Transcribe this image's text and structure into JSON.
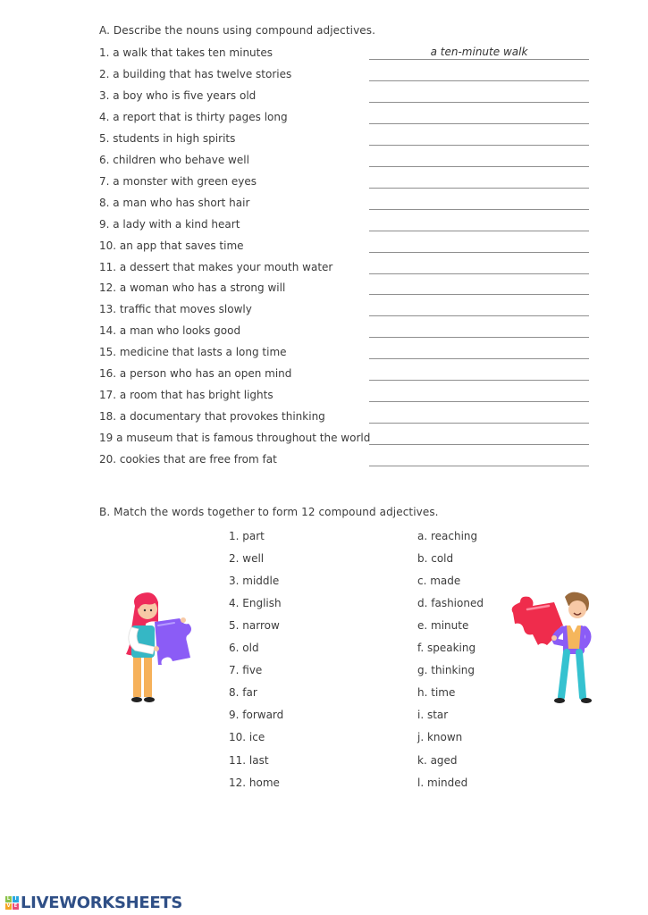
{
  "section_a": {
    "heading": "A. Describe the nouns using compound adjectives.",
    "items": [
      {
        "text": "1. a walk that takes ten minutes",
        "answer": "a ten-minute walk"
      },
      {
        "text": "2. a building that has twelve stories",
        "answer": ""
      },
      {
        "text": "3. a boy who is five years old",
        "answer": ""
      },
      {
        "text": "4. a report that is thirty pages long",
        "answer": ""
      },
      {
        "text": "5. students in high spirits",
        "answer": ""
      },
      {
        "text": "6. children who behave well",
        "answer": ""
      },
      {
        "text": "7. a monster with green eyes",
        "answer": ""
      },
      {
        "text": "8. a man who has short hair",
        "answer": ""
      },
      {
        "text": "9. a lady with a kind heart",
        "answer": ""
      },
      {
        "text": "10. an app that saves time",
        "answer": ""
      },
      {
        "text": "11. a dessert that makes your mouth water",
        "answer": ""
      },
      {
        "text": "12. a woman who has a strong will",
        "answer": ""
      },
      {
        "text": "13. traffic that moves slowly",
        "answer": ""
      },
      {
        "text": "14. a man who looks good",
        "answer": ""
      },
      {
        "text": "15. medicine that lasts a long time",
        "answer": ""
      },
      {
        "text": "16. a person who has an open mind",
        "answer": ""
      },
      {
        "text": "17. a room that has bright lights",
        "answer": ""
      },
      {
        "text": "18. a documentary that provokes thinking",
        "answer": ""
      },
      {
        "text": "19 a museum that is famous throughout the world",
        "answer": ""
      },
      {
        "text": "20. cookies that are free from fat",
        "answer": ""
      }
    ]
  },
  "section_b": {
    "heading": "B. Match the words together to form 12 compound adjectives.",
    "left": [
      "1. part",
      "2. well",
      "3. middle",
      "4. English",
      "5. narrow",
      "6. old",
      "7. five",
      "8. far",
      "9. forward",
      "10. ice",
      "11. last",
      "12. home"
    ],
    "right": [
      "a. reaching",
      "b. cold",
      "c. made",
      "d. fashioned",
      "e. minute",
      "f. speaking",
      "g. thinking",
      "h. time",
      "i. star",
      "j. known",
      "k. aged",
      "l. minded"
    ]
  },
  "illustrations": {
    "left": "girl-holding-purple-puzzle-piece",
    "right": "boy-holding-red-puzzle-piece"
  },
  "footer": {
    "logo_text": "LIVEWORKSHEETS",
    "logo_letters": [
      "L",
      "I",
      "V",
      "E"
    ],
    "logo_colors": [
      "#8bc34a",
      "#29a8e0",
      "#f5a623",
      "#e94e77"
    ],
    "brand_color": "#2f4f86"
  }
}
